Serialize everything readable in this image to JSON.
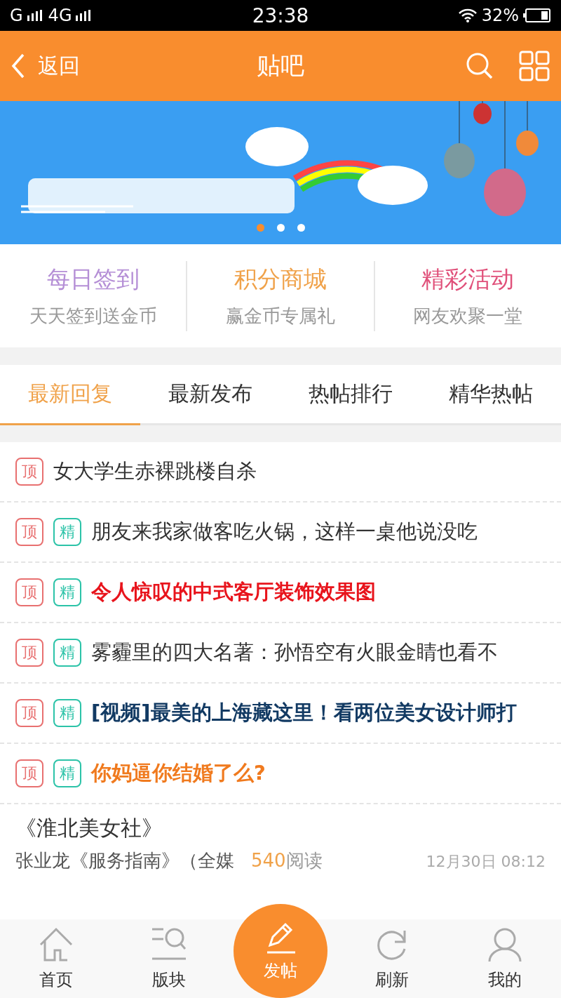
{
  "status_bar": {
    "carrier_1": "G",
    "carrier_2": "4G",
    "time": "23:38",
    "battery": "32%"
  },
  "header": {
    "back": "返回",
    "title": "贴吧"
  },
  "banner": {
    "dots": [
      {
        "selected": true
      },
      {
        "selected": false
      },
      {
        "selected": false
      }
    ]
  },
  "quick_links": [
    {
      "title": "每日签到",
      "subtitle": "天天签到送金币",
      "color": "#b58fd6"
    },
    {
      "title": "积分商城",
      "subtitle": "赢金币专属礼",
      "color": "#f0a24a"
    },
    {
      "title": "精彩活动",
      "subtitle": "网友欢聚一堂",
      "color": "#e0507a"
    }
  ],
  "tabs": [
    {
      "label": "最新回复",
      "selected": true
    },
    {
      "label": "最新发布",
      "selected": false
    },
    {
      "label": "热帖排行",
      "selected": false
    },
    {
      "label": "精华热帖",
      "selected": false
    }
  ],
  "posts": [
    {
      "badges": [
        {
          "kind": "top",
          "text": "顶"
        }
      ],
      "title": "女大学生赤裸跳楼自杀",
      "bold": false,
      "color": "#333333"
    },
    {
      "badges": [
        {
          "kind": "top",
          "text": "顶"
        },
        {
          "kind": "elite",
          "text": "精"
        }
      ],
      "title": "朋友来我家做客吃火锅，这样一桌他说没吃",
      "bold": false,
      "color": "#333333"
    },
    {
      "badges": [
        {
          "kind": "top",
          "text": "顶"
        },
        {
          "kind": "elite",
          "text": "精"
        }
      ],
      "title": "令人惊叹的中式客厅装饰效果图",
      "bold": true,
      "color": "#e8141c"
    },
    {
      "badges": [
        {
          "kind": "top",
          "text": "顶"
        },
        {
          "kind": "elite",
          "text": "精"
        }
      ],
      "title": "雾霾里的四大名著：孙悟空有火眼金睛也看不",
      "bold": false,
      "color": "#333333"
    },
    {
      "badges": [
        {
          "kind": "top",
          "text": "顶"
        },
        {
          "kind": "elite",
          "text": "精"
        }
      ],
      "title": "[视频]最美的上海藏这里！看两位美女设计师打",
      "bold": true,
      "color": "#123a63"
    },
    {
      "badges": [
        {
          "kind": "top",
          "text": "顶"
        },
        {
          "kind": "elite",
          "text": "精"
        }
      ],
      "title": "你妈逼你结婚了么?",
      "bold": true,
      "color": "#f07a1e"
    }
  ],
  "article": {
    "forum": "《淮北美女社》",
    "title": "张业龙《服务指南》（全媒",
    "reads": "540",
    "reads_label": "阅读",
    "time": "12月30日 08:12"
  },
  "bottom_nav": [
    {
      "kind": "home",
      "label": "首页"
    },
    {
      "kind": "boards",
      "label": "版块"
    },
    {
      "kind": "post",
      "label": "发帖"
    },
    {
      "kind": "refresh",
      "label": "刷新"
    },
    {
      "kind": "me",
      "label": "我的"
    }
  ]
}
